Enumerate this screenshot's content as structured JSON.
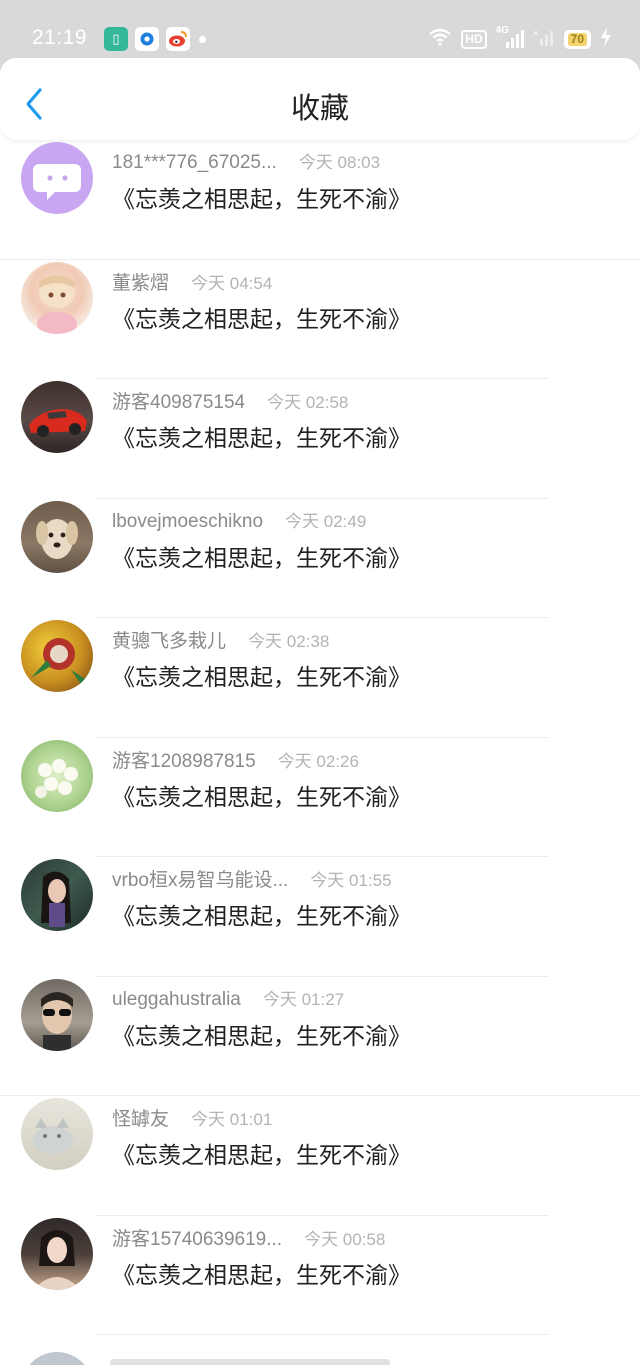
{
  "status_bar": {
    "time": "21:19",
    "network_badge": "HD",
    "signal_label": "4G",
    "battery_level": "70",
    "icons": [
      "app-icon-green",
      "app-icon-blue",
      "weibo-icon",
      "wifi-icon",
      "signal-icon",
      "charging-icon"
    ]
  },
  "header": {
    "title": "收藏",
    "back_icon": "chevron-left-icon",
    "accent": "#1e9bf0"
  },
  "favorites": [
    {
      "name": "181***776_67025...",
      "time": "今天 08:03",
      "title": "《忘羡之相思起，生死不渝》"
    },
    {
      "name": "董紫熠",
      "time": "今天 04:54",
      "title": "《忘羡之相思起，生死不渝》"
    },
    {
      "name": "游客409875154",
      "time": "今天 02:58",
      "title": "《忘羡之相思起，生死不渝》"
    },
    {
      "name": "lbovejmoeschikno",
      "time": "今天 02:49",
      "title": "《忘羡之相思起，生死不渝》"
    },
    {
      "name": "黄骢飞多栽儿",
      "time": "今天 02:38",
      "title": "《忘羡之相思起，生死不渝》"
    },
    {
      "name": "游客1208987815",
      "time": "今天 02:26",
      "title": "《忘羡之相思起，生死不渝》"
    },
    {
      "name": "vrbo桓x易智乌能设...",
      "time": "今天 01:55",
      "title": "《忘羡之相思起，生死不渝》"
    },
    {
      "name": "uleggahustralia",
      "time": "今天 01:27",
      "title": "《忘羡之相思起，生死不渝》"
    },
    {
      "name": "怪罅友",
      "time": "今天 01:01",
      "title": "《忘羡之相思起，生死不渝》"
    },
    {
      "name": "游客15740639619...",
      "time": "今天 00:58",
      "title": "《忘羡之相思起，生死不渝》"
    }
  ]
}
